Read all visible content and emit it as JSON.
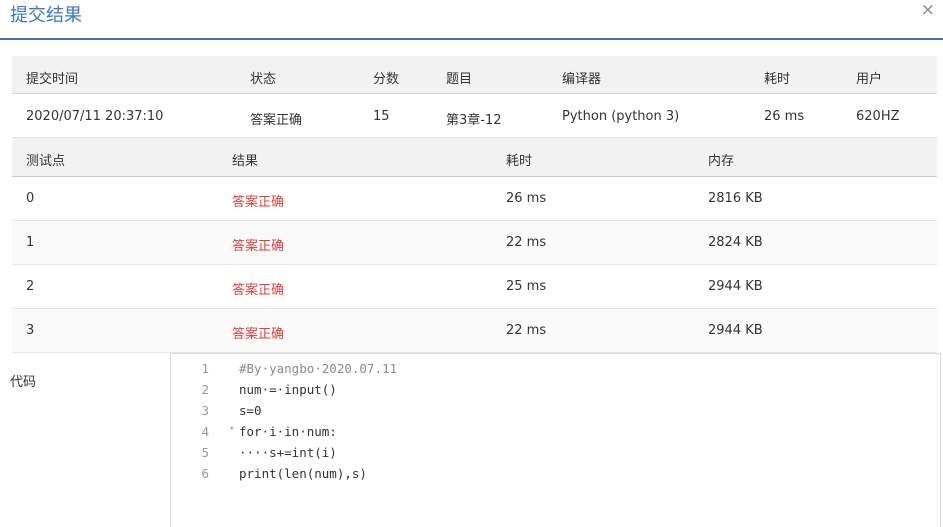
{
  "dialog": {
    "title": "提交结果",
    "close_glyph": "×"
  },
  "summary": {
    "headers": [
      "提交时间",
      "状态",
      "分数",
      "题目",
      "编译器",
      "耗时",
      "用户"
    ],
    "row": {
      "time": "2020/07/11 20:37:10",
      "status": "答案正确",
      "score": "15",
      "problem": "第3章-12",
      "compiler": "Python (python 3)",
      "duration": "26 ms",
      "user": "620HZ"
    }
  },
  "cases": {
    "headers": [
      "测试点",
      "结果",
      "耗时",
      "内存"
    ],
    "rows": [
      {
        "id": "0",
        "result": "答案正确",
        "time": "26 ms",
        "memory": "2816 KB"
      },
      {
        "id": "1",
        "result": "答案正确",
        "time": "22 ms",
        "memory": "2824 KB"
      },
      {
        "id": "2",
        "result": "答案正确",
        "time": "25 ms",
        "memory": "2944 KB"
      },
      {
        "id": "3",
        "result": "答案正确",
        "time": "22 ms",
        "memory": "2944 KB"
      }
    ]
  },
  "code": {
    "label": "代码",
    "line_numbers": [
      "1",
      "2",
      "3",
      "4",
      "5",
      "6"
    ],
    "lines": [
      "#By·yangbo·2020.07.11",
      "num·=·input()",
      "s=0",
      "for·i·in·num:",
      "····s+=int(i)",
      "print(len(num),s)"
    ],
    "fold_glyph": "▾"
  },
  "colors": {
    "accent": "#3a78c3",
    "status_ok": "#e0403a",
    "link": "#2f6eb5"
  }
}
